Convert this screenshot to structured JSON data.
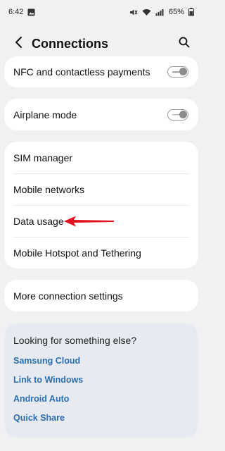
{
  "status_bar": {
    "time": "6:42",
    "battery": "65%"
  },
  "header": {
    "title": "Connections"
  },
  "settings": {
    "nfc": {
      "label": "NFC and contactless payments",
      "toggle_on": false
    },
    "airplane": {
      "label": "Airplane mode",
      "toggle_on": false
    },
    "sim_manager": "SIM manager",
    "mobile_networks": "Mobile networks",
    "data_usage": "Data usage",
    "hotspot": "Mobile Hotspot and Tethering",
    "more": "More connection settings"
  },
  "suggestions": {
    "title": "Looking for something else?",
    "links": [
      "Samsung Cloud",
      "Link to Windows",
      "Android Auto",
      "Quick Share"
    ]
  },
  "colors": {
    "link": "#2a6db0",
    "annotation_arrow": "#e0141e"
  }
}
